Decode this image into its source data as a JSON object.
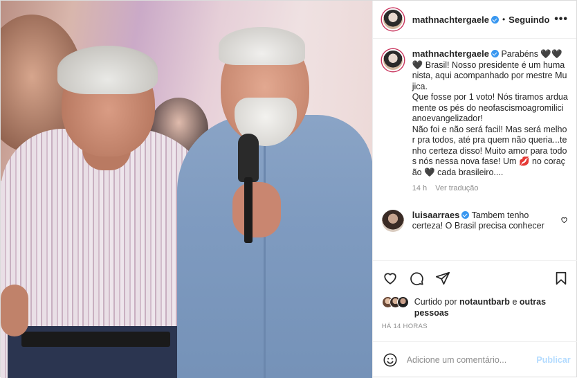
{
  "post": {
    "author": "mathnachtergaele",
    "follow_status": "Seguindo",
    "dot": "•",
    "more": "•••"
  },
  "caption": {
    "author": "mathnachtergaele",
    "text": "Parabéns 🖤🖤🖤 Brasil! Nosso presidente é um humanista, aqui acompanhado por mestre Mujica.\nQue fosse por 1 voto! Nós tiramos arduamente os pés do neofascismoagromilicianoevangelizador!\nNão foi e não será facil! Mas será melhor pra todos, até pra quem não queria...tenho certeza disso! Muito amor para todos nós nessa nova fase! Um 💋 no coração 🖤 cada brasileiro....",
    "age": "14 h",
    "translate": "Ver tradução"
  },
  "reply": {
    "author": "luisaarraes",
    "text": "Tambem tenho certeza! O Brasil precisa conhecer",
    "like_icon": "heart-outline"
  },
  "likes": {
    "prefix": "Curtido por",
    "user": "notauntbarb",
    "connector": "e",
    "others": "outras pessoas"
  },
  "timestamp": "HÁ 14 HORAS",
  "add_comment": {
    "placeholder": "Adicione um comentário...",
    "publish": "Publicar",
    "emoji_icon": "smiley-icon"
  },
  "colors": {
    "verified": "#3897f0",
    "publish_disabled": "#b3dbff",
    "muted": "#8e8e8e"
  }
}
